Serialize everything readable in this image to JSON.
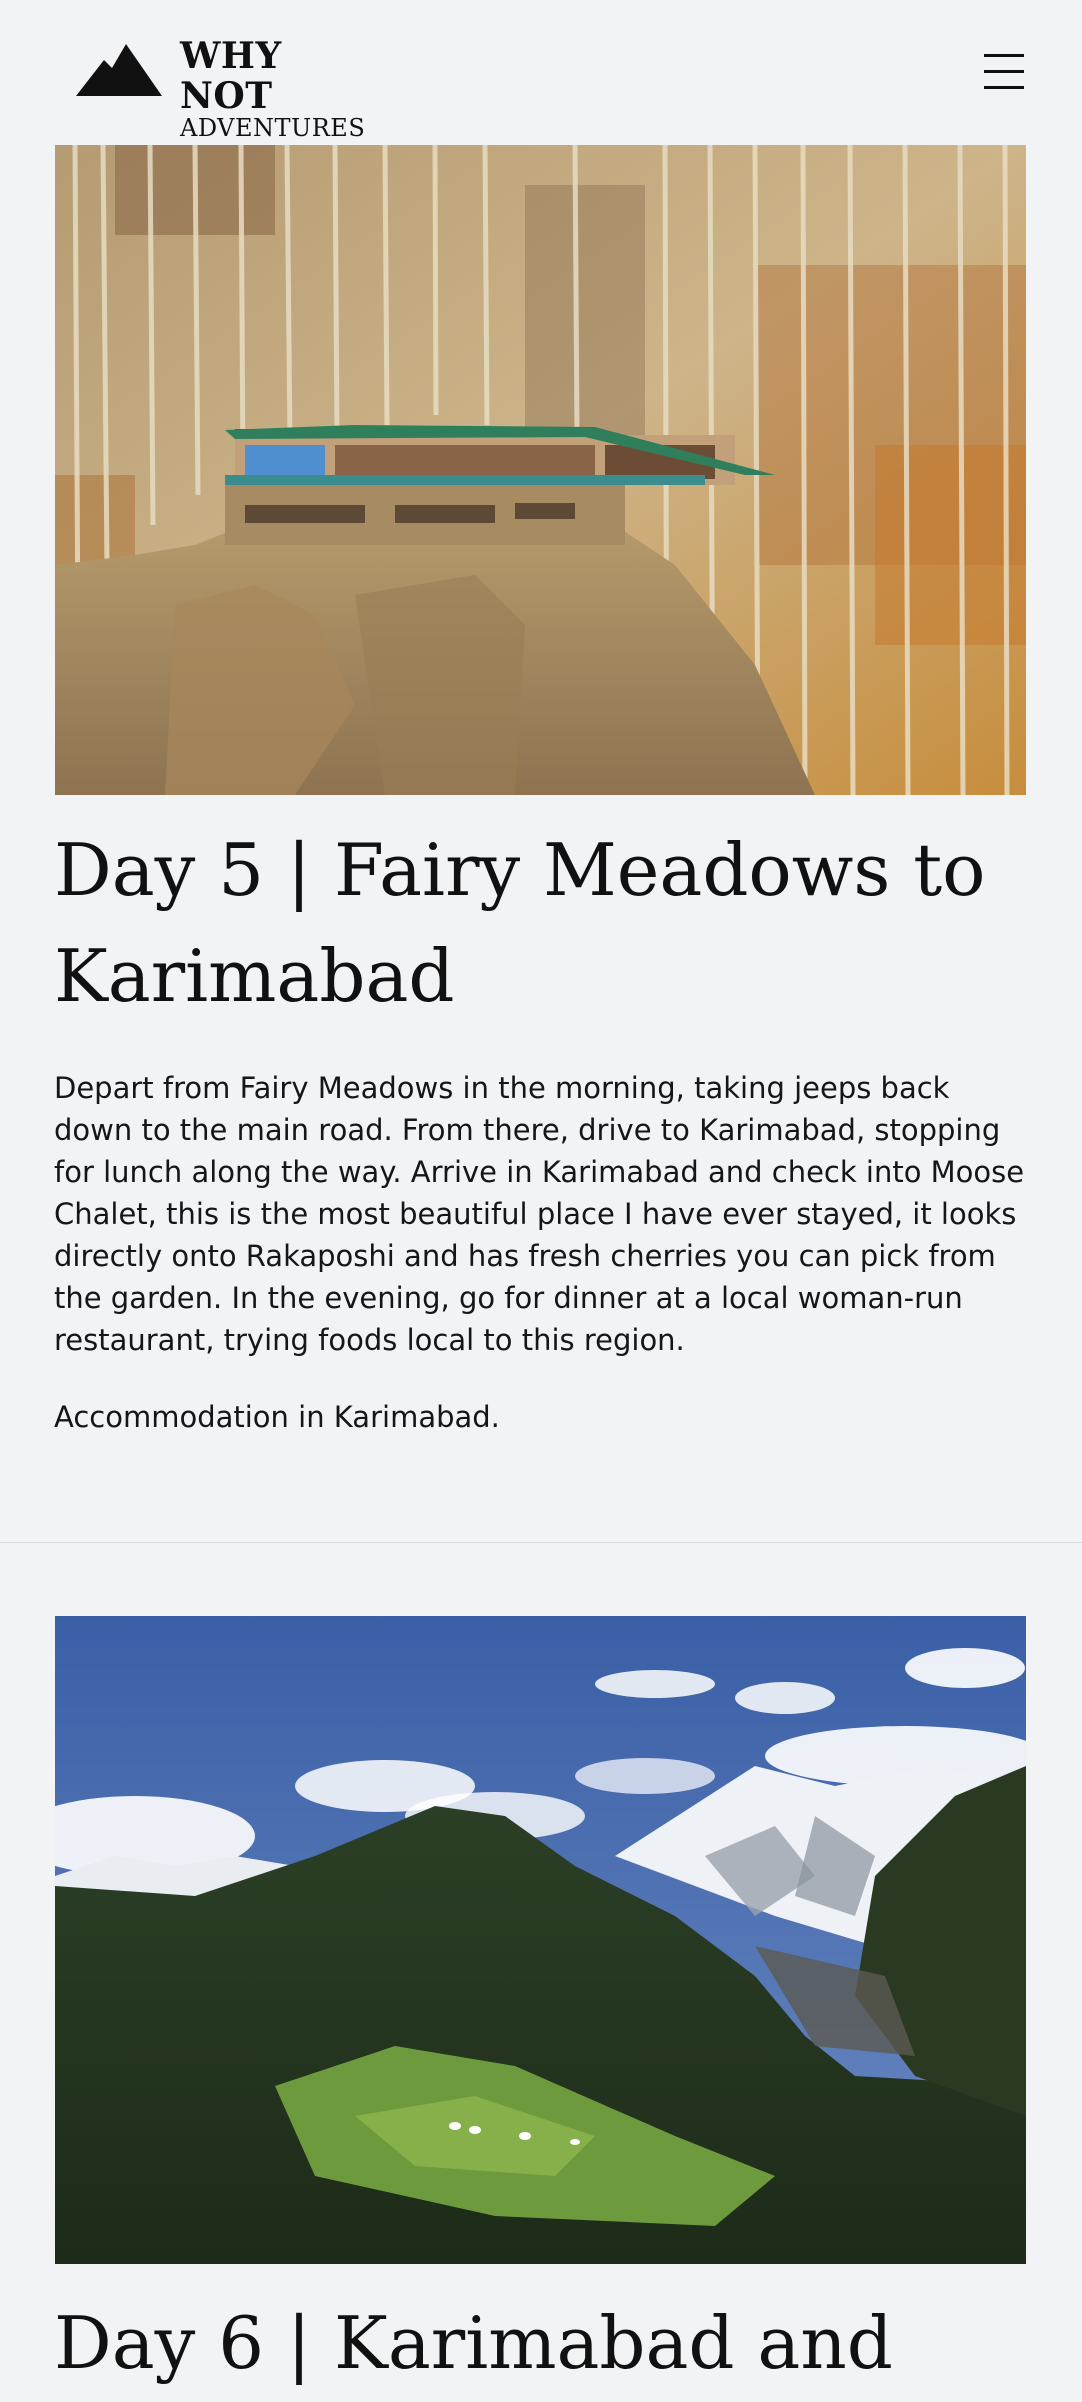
{
  "header": {
    "brand_line1": "WHY NOT",
    "brand_line2": "ADVENTURES",
    "logo_icon": "mountain-icon",
    "menu_icon": "hamburger-menu-icon"
  },
  "days": [
    {
      "title": "Day 5 | Fairy Meadows to Karimabad",
      "body": "Depart from Fairy Meadows in the morning, taking jeeps back down to the main road. From there, drive to Karimabad, stopping for lunch along the way. Arrive in Karimabad and check into Moose Chalet, this is the most beautiful place I have ever stayed, it looks directly onto Rakaposhi and has fresh cherries you can pick from the garden. In the evening, go for dinner at a local woman-run restaurant, trying foods local to this region.",
      "accommodation": "Accommodation in Karimabad."
    },
    {
      "title": "Day 6 | Karimabad and"
    }
  ],
  "colors": {
    "page_background": "#f2f3f5",
    "text": "#111111",
    "divider": "#dcdcdc"
  }
}
